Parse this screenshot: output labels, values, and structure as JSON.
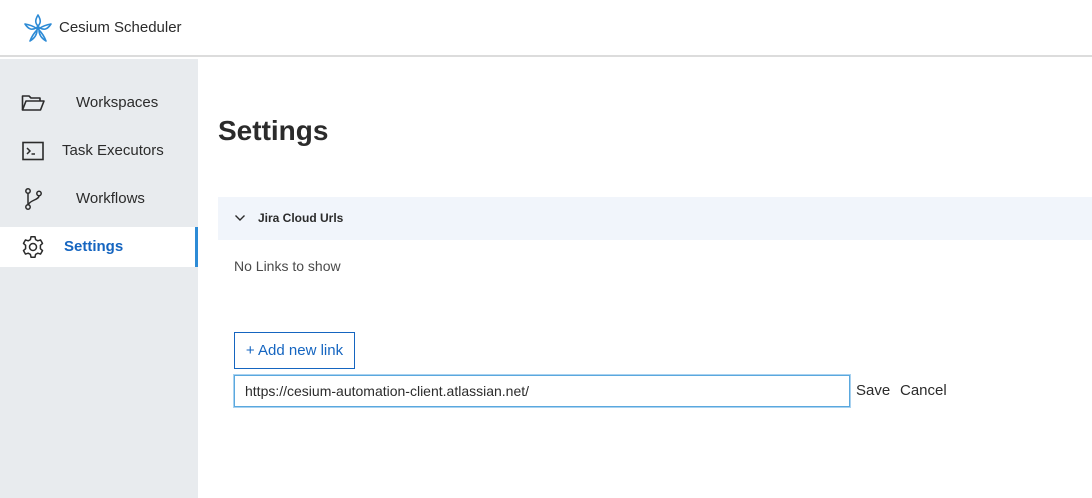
{
  "app": {
    "title": "Cesium Scheduler"
  },
  "sidebar": {
    "items": [
      {
        "label": "Workspaces",
        "icon": "folder-icon"
      },
      {
        "label": "Task Executors",
        "icon": "terminal-icon"
      },
      {
        "label": "Workflows",
        "icon": "git-branch-icon"
      },
      {
        "label": "Settings",
        "icon": "gear-icon",
        "active": true
      }
    ],
    "active_color": "#1565c0"
  },
  "main": {
    "title": "Settings",
    "section": {
      "title": "Jira Cloud Urls",
      "empty_text": "No Links to show",
      "add_button": "+ Add new link",
      "input_value": "https://cesium-automation-client.atlassian.net/",
      "save_label": "Save",
      "cancel_label": "Cancel"
    }
  }
}
